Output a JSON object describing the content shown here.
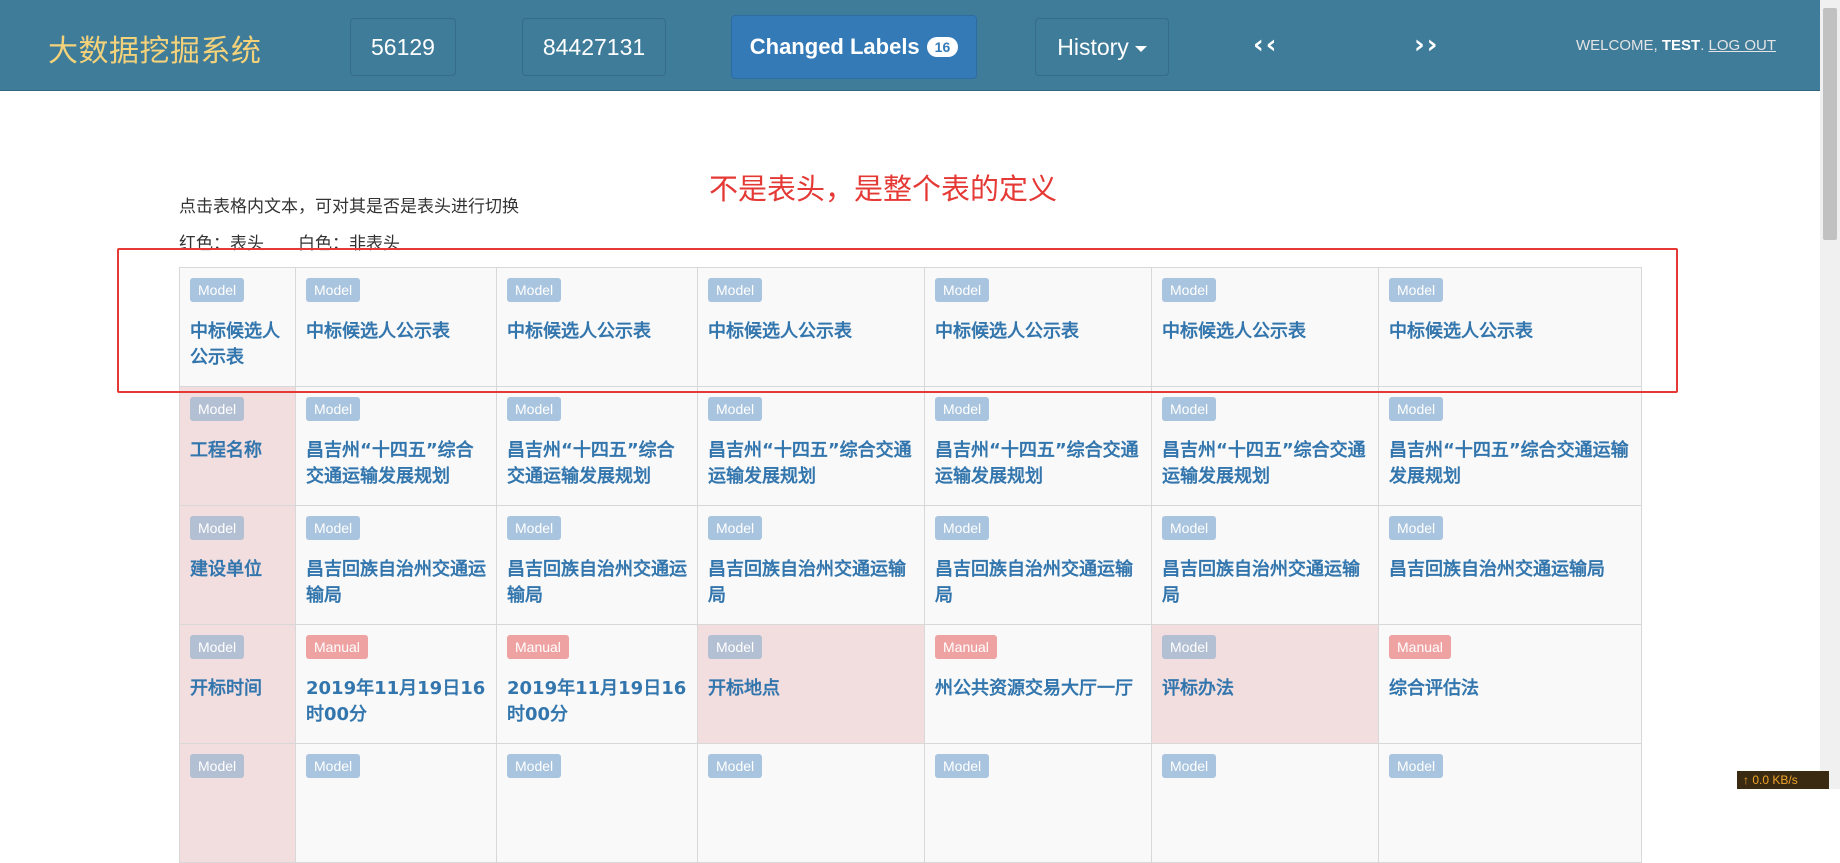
{
  "navbar": {
    "brand": "大数据挖掘系统",
    "counter_a": "56129",
    "counter_b": "84427131",
    "changed_labels": "Changed Labels",
    "changed_count": "16",
    "history": "History",
    "prev_arrows": "‹‹",
    "next_arrows": "››",
    "welcome_prefix": "WELCOME,",
    "user": "TEST",
    "logout": "LOG OUT"
  },
  "annotation": "不是表头，是整个表的定义",
  "instructions": {
    "line1": "点击表格内文本，可对其是否是表头进行切换",
    "red_legend": "红色：表头",
    "white_legend": "白色：非表头"
  },
  "table": {
    "rows": [
      [
        {
          "tag": "Model",
          "text": "中标候选人公示表",
          "hdr": false
        },
        {
          "tag": "Model",
          "text": "中标候选人公示表",
          "hdr": false
        },
        {
          "tag": "Model",
          "text": "中标候选人公示表",
          "hdr": false
        },
        {
          "tag": "Model",
          "text": "中标候选人公示表",
          "hdr": false
        },
        {
          "tag": "Model",
          "text": "中标候选人公示表",
          "hdr": false
        },
        {
          "tag": "Model",
          "text": "中标候选人公示表",
          "hdr": false
        },
        {
          "tag": "Model",
          "text": "中标候选人公示表",
          "hdr": false
        }
      ],
      [
        {
          "tag": "Model",
          "text": "工程名称",
          "hdr": true
        },
        {
          "tag": "Model",
          "text": "昌吉州“十四五”综合交通运输发展规划",
          "hdr": false
        },
        {
          "tag": "Model",
          "text": "昌吉州“十四五”综合交通运输发展规划",
          "hdr": false
        },
        {
          "tag": "Model",
          "text": "昌吉州“十四五”综合交通运输发展规划",
          "hdr": false
        },
        {
          "tag": "Model",
          "text": "昌吉州“十四五”综合交通运输发展规划",
          "hdr": false
        },
        {
          "tag": "Model",
          "text": "昌吉州“十四五”综合交通运输发展规划",
          "hdr": false
        },
        {
          "tag": "Model",
          "text": "昌吉州“十四五”综合交通运输发展规划",
          "hdr": false
        }
      ],
      [
        {
          "tag": "Model",
          "text": "建设单位",
          "hdr": true
        },
        {
          "tag": "Model",
          "text": "昌吉回族自治州交通运输局",
          "hdr": false
        },
        {
          "tag": "Model",
          "text": "昌吉回族自治州交通运输局",
          "hdr": false
        },
        {
          "tag": "Model",
          "text": "昌吉回族自治州交通运输局",
          "hdr": false
        },
        {
          "tag": "Model",
          "text": "昌吉回族自治州交通运输局",
          "hdr": false
        },
        {
          "tag": "Model",
          "text": "昌吉回族自治州交通运输局",
          "hdr": false
        },
        {
          "tag": "Model",
          "text": "昌吉回族自治州交通运输局",
          "hdr": false
        }
      ],
      [
        {
          "tag": "Model",
          "text": "开标时间",
          "hdr": true
        },
        {
          "tag": "Manual",
          "text": "2019年11月19日16时00分",
          "hdr": false
        },
        {
          "tag": "Manual",
          "text": "2019年11月19日16时00分",
          "hdr": false
        },
        {
          "tag": "Model",
          "text": "开标地点",
          "hdr": true
        },
        {
          "tag": "Manual",
          "text": "州公共资源交易大厅一厅",
          "hdr": false
        },
        {
          "tag": "Model",
          "text": "评标办法",
          "hdr": true
        },
        {
          "tag": "Manual",
          "text": "综合评估法",
          "hdr": false
        }
      ],
      [
        {
          "tag": "Model",
          "text": "",
          "hdr": true
        },
        {
          "tag": "Model",
          "text": "",
          "hdr": false
        },
        {
          "tag": "Model",
          "text": "",
          "hdr": false
        },
        {
          "tag": "Model",
          "text": "",
          "hdr": false
        },
        {
          "tag": "Model",
          "text": "",
          "hdr": false
        },
        {
          "tag": "Model",
          "text": "",
          "hdr": false
        },
        {
          "tag": "Model",
          "text": "",
          "hdr": false
        }
      ]
    ]
  },
  "status_speed": "↑ 0.0 KB/s"
}
